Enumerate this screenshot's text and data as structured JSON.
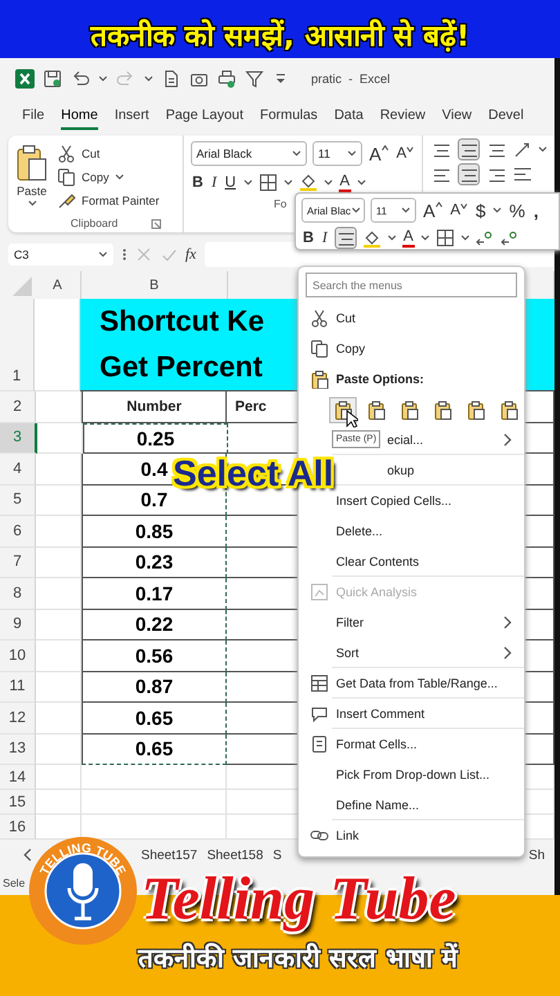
{
  "banner": {
    "text": "तकनीक को समझें, आसानी से बढ़ें!"
  },
  "title_bar": {
    "document": "pratic  -  Excel"
  },
  "ribbon_tabs": [
    {
      "label": "File",
      "selected": false
    },
    {
      "label": "Home",
      "selected": true
    },
    {
      "label": "Insert",
      "selected": false
    },
    {
      "label": "Page Layout",
      "selected": false
    },
    {
      "label": "Formulas",
      "selected": false
    },
    {
      "label": "Data",
      "selected": false
    },
    {
      "label": "Review",
      "selected": false
    },
    {
      "label": "View",
      "selected": false
    },
    {
      "label": "Devel",
      "selected": false
    }
  ],
  "clipboard": {
    "paste": "Paste",
    "cut": "Cut",
    "copy": "Copy",
    "format_painter": "Format Painter",
    "group_label": "Clipboard"
  },
  "font_group": {
    "font": "Arial Black",
    "size": "11",
    "grow": "A",
    "shrink": "A",
    "bold": "B",
    "italic": "I",
    "underline": "U",
    "font_color": "A",
    "group_label": "Fo"
  },
  "alignment": {
    "center_selected": true
  },
  "mini_toolbar": {
    "font": "Arial Blac",
    "size": "11",
    "grow": "A",
    "shrink": "A",
    "currency": "$",
    "percent": "%",
    "comma": ",",
    "bold": "B",
    "italic": "I",
    "center_selected": true,
    "font_color": "A"
  },
  "formula_bar": {
    "name_box": "C3",
    "fx": "fx"
  },
  "sheet": {
    "columns": [
      "A",
      "B"
    ],
    "title_lines": [
      "Shortcut Ke",
      "Get Percent"
    ],
    "title_row": "1",
    "rows": [
      {
        "label": "2",
        "kind": "header",
        "b": "Number",
        "c": "Perc",
        "selected": false,
        "copied": false
      },
      {
        "label": "3",
        "kind": "data",
        "b": "0.25",
        "selected": true,
        "copied": true
      },
      {
        "label": "4",
        "kind": "data",
        "b": "0.4",
        "selected": false,
        "copied": true
      },
      {
        "label": "5",
        "kind": "data",
        "b": "0.7",
        "selected": false,
        "copied": true
      },
      {
        "label": "6",
        "kind": "data",
        "b": "0.85",
        "selected": false,
        "copied": true
      },
      {
        "label": "7",
        "kind": "data",
        "b": "0.23",
        "selected": false,
        "copied": true
      },
      {
        "label": "8",
        "kind": "data",
        "b": "0.17",
        "selected": false,
        "copied": true
      },
      {
        "label": "9",
        "kind": "data",
        "b": "0.22",
        "selected": false,
        "copied": true
      },
      {
        "label": "10",
        "kind": "data",
        "b": "0.56",
        "selected": false,
        "copied": true
      },
      {
        "label": "11",
        "kind": "data",
        "b": "0.87",
        "selected": false,
        "copied": true
      },
      {
        "label": "12",
        "kind": "data",
        "b": "0.65",
        "selected": false,
        "copied": true
      },
      {
        "label": "13",
        "kind": "data",
        "b": "0.65",
        "selected": false,
        "copied": true
      },
      {
        "label": "14",
        "kind": "empty",
        "selected": false,
        "copied": false
      },
      {
        "label": "15",
        "kind": "empty",
        "selected": false,
        "copied": false
      },
      {
        "label": "16",
        "kind": "empty",
        "selected": false,
        "copied": false
      }
    ]
  },
  "overlay_caption": "Select All",
  "context_menu": {
    "search_placeholder": "Search the menus",
    "items": [
      {
        "kind": "item",
        "label": "Cut",
        "submenu": false,
        "disabled": false,
        "separator_after": false
      },
      {
        "kind": "item",
        "label": "Copy",
        "submenu": false,
        "disabled": false,
        "separator_after": false
      },
      {
        "kind": "header",
        "label": "Paste Options:"
      },
      {
        "kind": "paste_icons",
        "buttons": [
          {
            "selected": true
          },
          {
            "selected": false
          },
          {
            "selected": false
          },
          {
            "selected": false
          },
          {
            "selected": false
          },
          {
            "selected": false
          }
        ]
      },
      {
        "kind": "item",
        "label": "ecial...",
        "tooltip": "Paste (P)",
        "covered": true,
        "submenu": true,
        "disabled": false,
        "separator_after": true
      },
      {
        "kind": "item",
        "label": "okup",
        "covered": true,
        "submenu": false,
        "disabled": false,
        "separator_after": true
      },
      {
        "kind": "item",
        "label": "Insert Copied Cells...",
        "submenu": false,
        "disabled": false,
        "separator_after": false
      },
      {
        "kind": "item",
        "label": "Delete...",
        "submenu": false,
        "disabled": false,
        "separator_after": false
      },
      {
        "kind": "item",
        "label": "Clear Contents",
        "submenu": false,
        "disabled": false,
        "separator_after": true
      },
      {
        "kind": "item",
        "label": "Quick Analysis",
        "submenu": false,
        "disabled": true,
        "separator_after": false
      },
      {
        "kind": "item",
        "label": "Filter",
        "submenu": true,
        "disabled": false,
        "separator_after": false
      },
      {
        "kind": "item",
        "label": "Sort",
        "submenu": true,
        "disabled": false,
        "separator_after": true
      },
      {
        "kind": "item",
        "label": "Get Data from Table/Range...",
        "submenu": false,
        "disabled": false,
        "separator_after": true
      },
      {
        "kind": "item",
        "label": "Insert Comment",
        "submenu": false,
        "disabled": false,
        "separator_after": true
      },
      {
        "kind": "item",
        "label": "Format Cells...",
        "submenu": false,
        "disabled": false,
        "separator_after": false
      },
      {
        "kind": "item",
        "label": "Pick From Drop-down List...",
        "submenu": false,
        "disabled": false,
        "separator_after": false
      },
      {
        "kind": "item",
        "label": "Define Name...",
        "submenu": false,
        "disabled": false,
        "separator_after": true
      },
      {
        "kind": "item",
        "label": "Link",
        "submenu": false,
        "disabled": false,
        "separator_after": false
      }
    ]
  },
  "sheet_tabs": [
    {
      "label": "Sheet157"
    },
    {
      "label": "Sheet158"
    },
    {
      "label": "S"
    },
    {
      "label": "Sh"
    }
  ],
  "status_bar": {
    "text": "Sele"
  },
  "footer": {
    "brand": "Telling Tube",
    "tagline": "तकनीकी जानकारी सरल भाषा में",
    "logo_ring": "TELLING TUBE"
  }
}
